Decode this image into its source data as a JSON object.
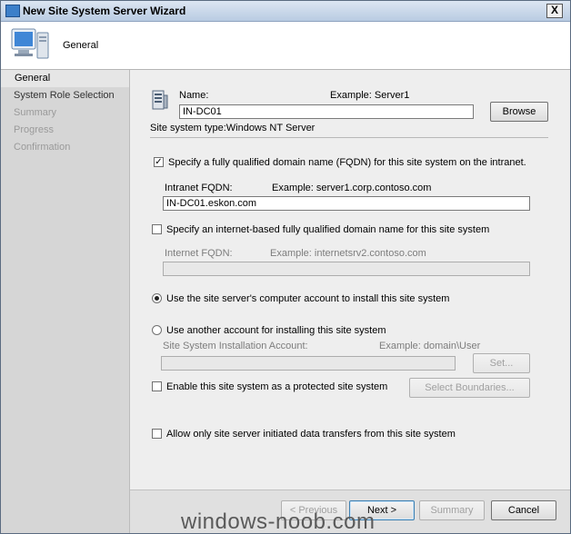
{
  "window": {
    "title": "New Site System Server Wizard",
    "close_glyph": "X"
  },
  "header": {
    "title": "General"
  },
  "sidebar": {
    "items": [
      {
        "label": "General"
      },
      {
        "label": "System Role Selection"
      },
      {
        "label": "Summary"
      },
      {
        "label": "Progress"
      },
      {
        "label": "Confirmation"
      }
    ]
  },
  "form": {
    "name_label": "Name:",
    "name_example": "Example: Server1",
    "name_value": "IN-DC01",
    "browse_label": "Browse",
    "site_system_type": "Site system type:Windows NT Server",
    "fqdn_checkbox_label": "Specify a fully qualified domain name (FQDN) for this site system on the intranet.",
    "fqdn_checked": true,
    "intranet_fqdn_label": "Intranet FQDN:",
    "intranet_fqdn_example": "Example: server1.corp.contoso.com",
    "intranet_fqdn_value": "IN-DC01.eskon.com",
    "internet_checkbox_label": "Specify an internet-based fully qualified domain name for this site system",
    "internet_checked": false,
    "internet_fqdn_label": "Internet FQDN:",
    "internet_fqdn_example": "Example: internetsrv2.contoso.com",
    "internet_fqdn_value": "",
    "radio_computer_account": "Use the site server's computer account to install this site system",
    "radio_another_account": "Use another account for installing this site system",
    "install_account_label": "Site System Installation Account:",
    "install_account_example": "Example: domain\\User",
    "install_account_value": "",
    "set_label": "Set...",
    "protected_checkbox_label": "Enable this site system as a protected site system",
    "protected_checked": false,
    "select_boundaries_label": "Select Boundaries...",
    "allow_transfers_label": "Allow only site server initiated data transfers from this site system",
    "allow_transfers_checked": false
  },
  "footer": {
    "previous_label": "< Previous",
    "next_label": "Next >",
    "summary_label": "Summary",
    "cancel_label": "Cancel"
  },
  "watermark": "windows-noob.com"
}
